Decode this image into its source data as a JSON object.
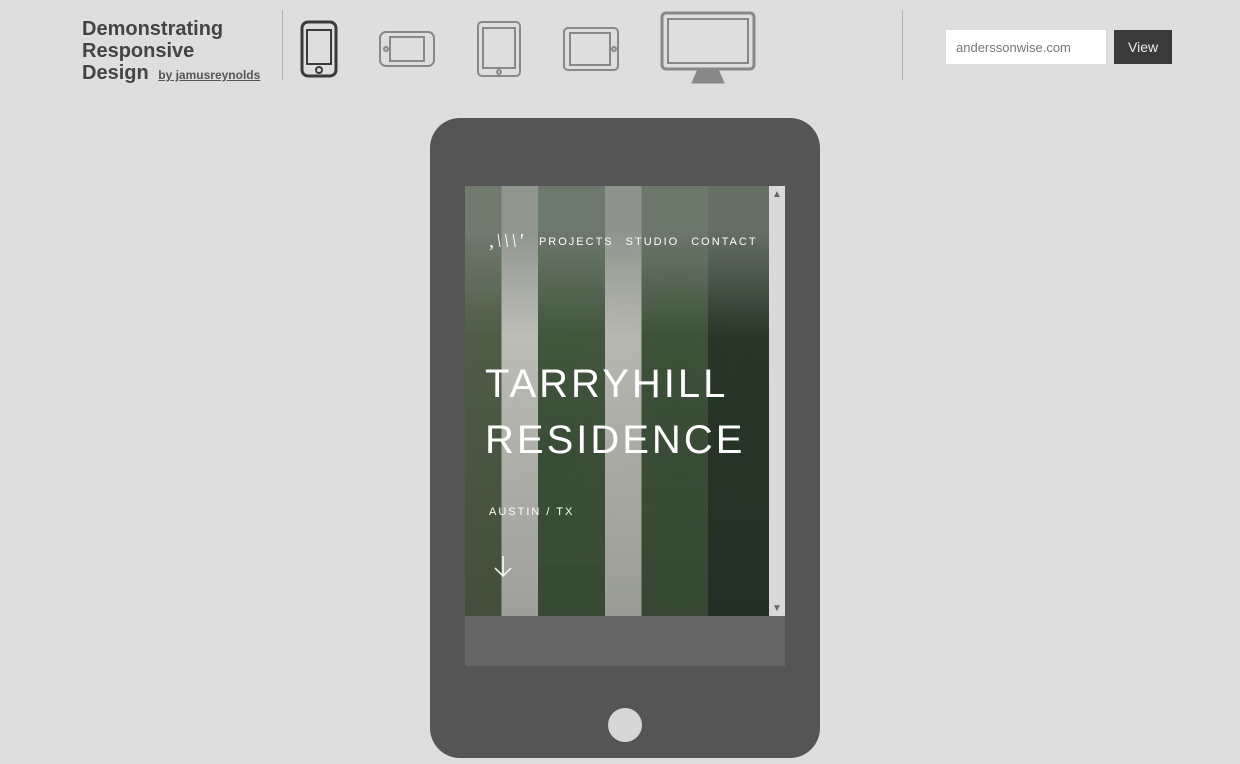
{
  "header": {
    "title_line1": "Demonstrating",
    "title_line2": "Responsive",
    "title_line3": "Design",
    "byline": "by jamusreynolds"
  },
  "devices": [
    {
      "name": "phone-portrait",
      "active": true
    },
    {
      "name": "phone-landscape",
      "active": false
    },
    {
      "name": "tablet-portrait",
      "active": false
    },
    {
      "name": "tablet-landscape",
      "active": false
    },
    {
      "name": "desktop",
      "active": false
    }
  ],
  "url_form": {
    "value": "anderssonwise.com",
    "button": "View"
  },
  "preview": {
    "nav": {
      "logo": ",\\\\\\'",
      "items": [
        "PROJECTS",
        "STUDIO",
        "CONTACT"
      ]
    },
    "hero": {
      "title_line1": "TARRYHILL",
      "title_line2": "RESIDENCE",
      "location": "AUSTIN / TX"
    }
  }
}
